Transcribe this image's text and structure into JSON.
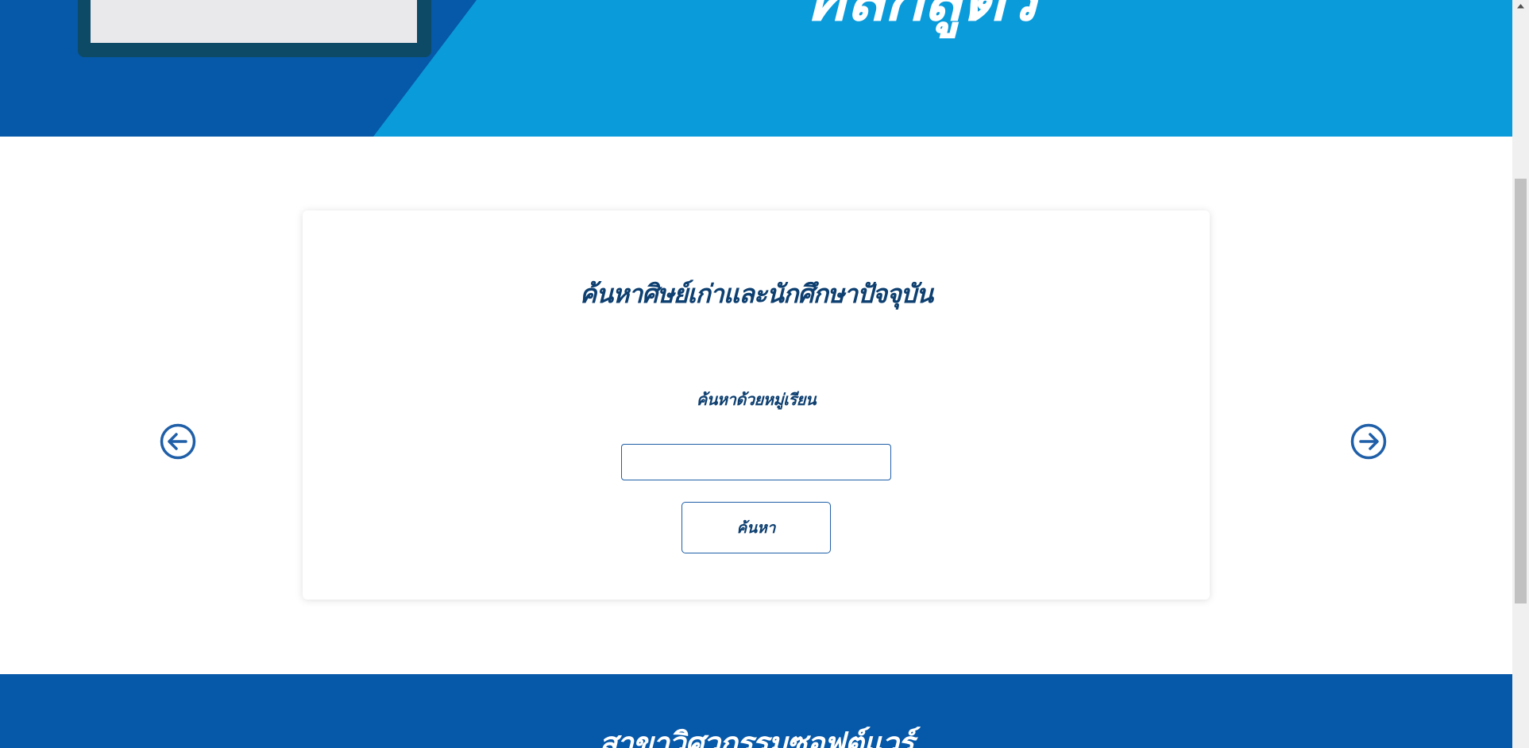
{
  "hero": {
    "title": "หลักสูตร",
    "colors": {
      "light_blue": "#0a9bdb",
      "dark_blue": "#0658a8",
      "gear": "#a0005a"
    },
    "icons": [
      "laptop-icon",
      "gear-icon"
    ]
  },
  "search_card": {
    "title": "ค้นหาศิษย์เก่าและนักศึกษาปัจจุบัน",
    "label": "ค้นหาด้วยหมู่เรียน",
    "input_value": "",
    "input_placeholder": "",
    "button_label": "ค้นหา"
  },
  "carousel": {
    "prev_icon": "arrow-left-circle-icon",
    "next_icon": "arrow-right-circle-icon",
    "arrow_color": "#1f5fa8"
  },
  "footer": {
    "title": "สาขาวิศวกรรมซอฟต์แวร์"
  },
  "theme": {
    "text_dark_blue": "#0d3f70",
    "border_blue": "#1f5fa8"
  }
}
